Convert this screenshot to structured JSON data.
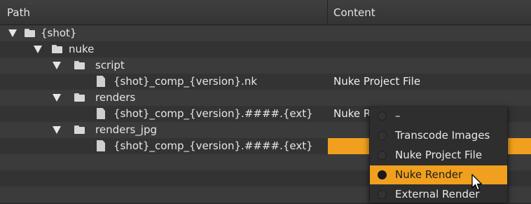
{
  "columns": {
    "path": "Path",
    "content": "Content"
  },
  "rows": [
    {
      "name": "{shot}",
      "type": "folder",
      "expanded": true,
      "content": ""
    },
    {
      "name": "nuke",
      "type": "folder",
      "expanded": true,
      "content": ""
    },
    {
      "name": "script",
      "type": "folder",
      "expanded": true,
      "content": ""
    },
    {
      "name": "{shot}_comp_{version}.nk",
      "type": "file",
      "content": "Nuke Project File"
    },
    {
      "name": "renders",
      "type": "folder",
      "expanded": true,
      "content": ""
    },
    {
      "name": "{shot}_comp_{version}.####.{ext}",
      "type": "file",
      "content": "Nuke Render"
    },
    {
      "name": "renders_jpg",
      "type": "folder",
      "expanded": true,
      "content": ""
    },
    {
      "name": "{shot}_comp_{version}.####.{ext}",
      "type": "file",
      "content": ""
    }
  ],
  "content_menu": {
    "options": [
      "–",
      "Transcode Images",
      "Nuke Project File",
      "Nuke Render",
      "External Render"
    ],
    "selected": "Nuke Render"
  },
  "colors": {
    "accent": "#f0a01e",
    "background": "#3b3b3b",
    "text": "#e6e6e6"
  }
}
